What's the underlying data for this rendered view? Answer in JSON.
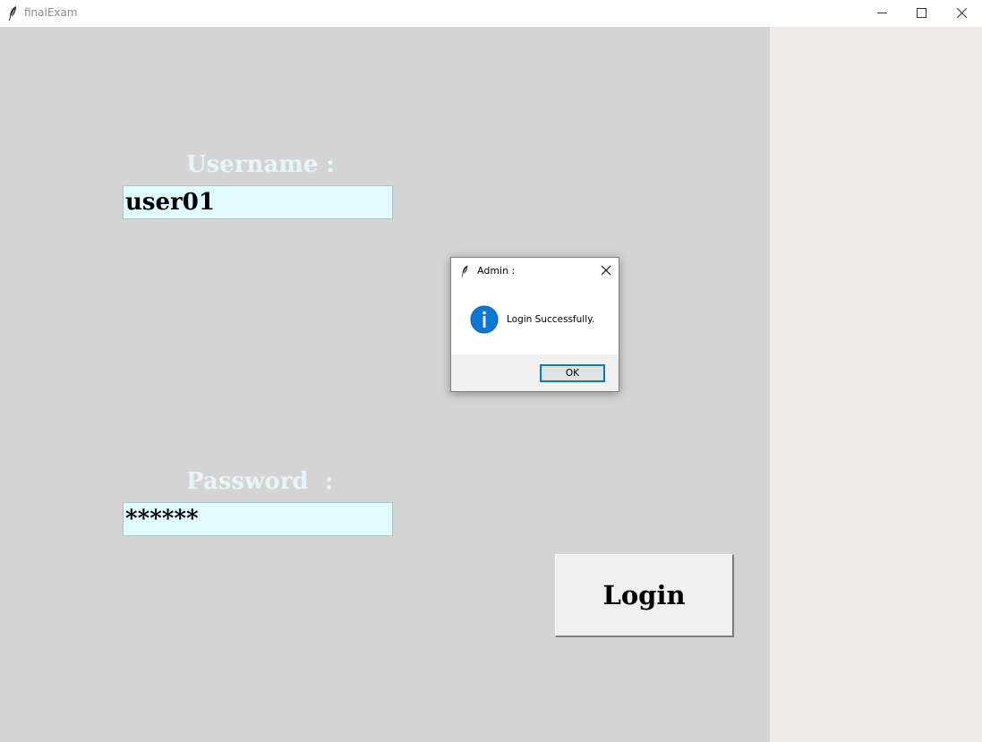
{
  "window": {
    "title": "finalExam",
    "controls": [
      "minimize-icon",
      "maximize-icon",
      "close-icon"
    ]
  },
  "form": {
    "username_label": "Username :",
    "username_value": "user01",
    "password_label": "Password  :",
    "password_value": "******",
    "login_label": "Login"
  },
  "dialog": {
    "title": "Admin :",
    "message": "Login Successfully.",
    "ok_label": "OK",
    "icon": "info-icon"
  },
  "colors": {
    "canvas_bg": "#d4d4d4",
    "label_text": "#e6f5f8",
    "field_bg": "#e0fcfe",
    "side_bg": "#ecebe7",
    "info_blue": "#0a78d4"
  }
}
